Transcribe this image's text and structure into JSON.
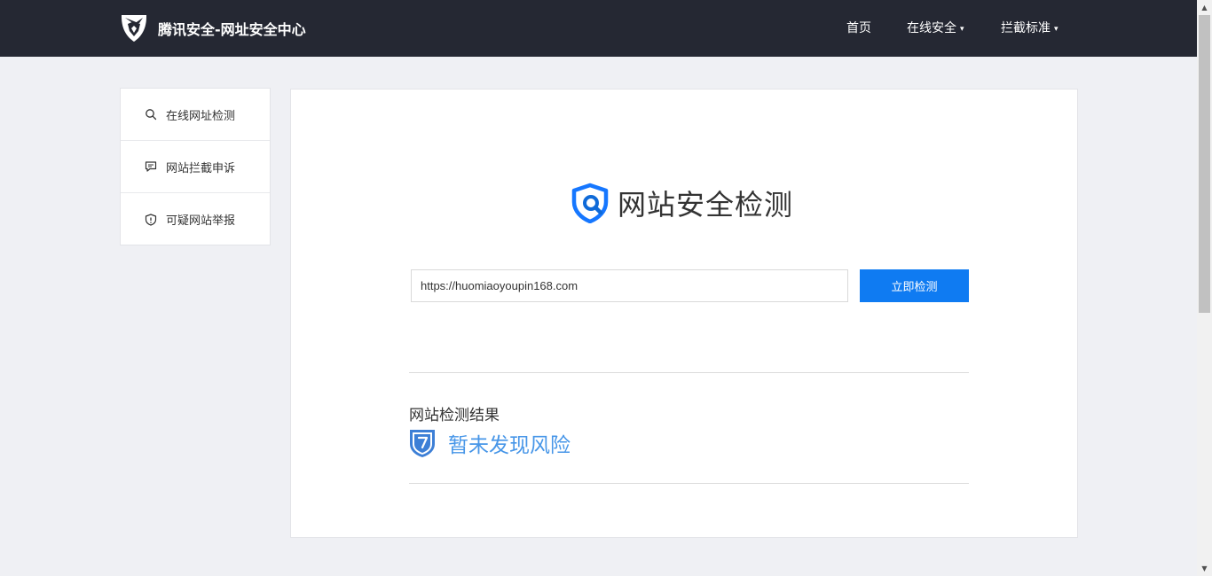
{
  "header": {
    "title": "腾讯安全-网址安全中心",
    "nav": [
      {
        "label": "首页",
        "has_dropdown": false
      },
      {
        "label": "在线安全",
        "has_dropdown": true
      },
      {
        "label": "拦截标准",
        "has_dropdown": true
      }
    ],
    "caret": "▾"
  },
  "sidebar": {
    "items": [
      {
        "label": "在线网址检测",
        "icon": "search-icon"
      },
      {
        "label": "网站拦截申诉",
        "icon": "chat-icon"
      },
      {
        "label": "可疑网站举报",
        "icon": "shield-alert-icon"
      }
    ]
  },
  "main": {
    "headline": "网站安全检测",
    "url_value": "https://huomiaoyoupin168.com",
    "check_button_label": "立即检测",
    "result_title": "网站检测结果",
    "result_status": "暂未发现风险"
  },
  "colors": {
    "header_bg": "#252833",
    "page_bg": "#eff0f4",
    "primary": "#0f7bf2",
    "result_text": "#4796e8"
  }
}
